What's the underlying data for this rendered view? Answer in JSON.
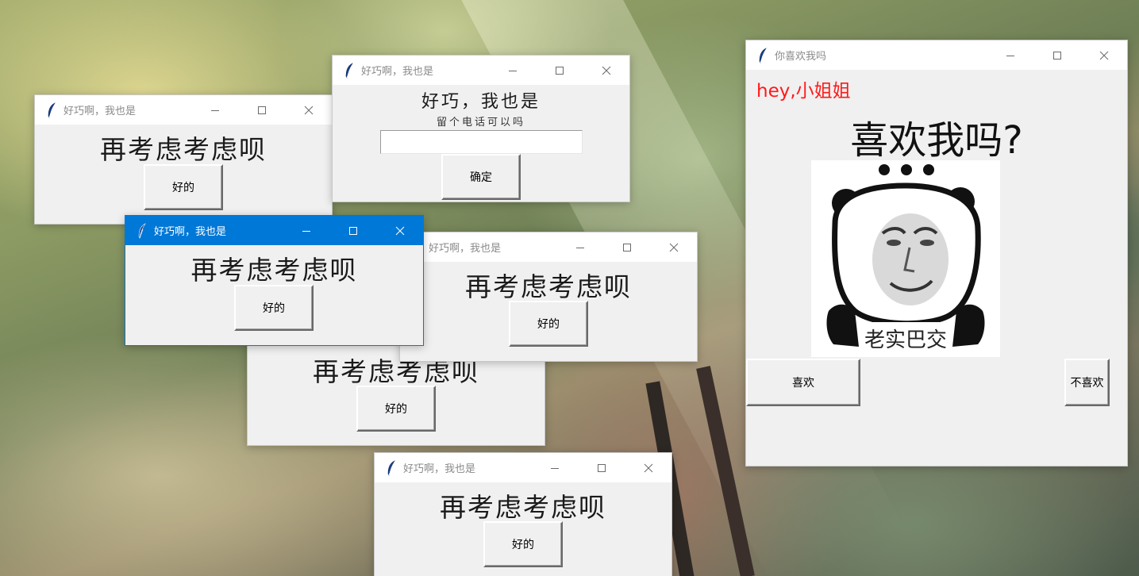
{
  "popup_title": "好巧啊，我也是",
  "reconsider_text": "再考虑考虑呗",
  "ok_label": "好的",
  "phone_window": {
    "title": "好巧啊，我也是",
    "heading": "好巧，我也是",
    "subtitle": "留个电话可以吗",
    "input_value": "",
    "confirm_label": "确定"
  },
  "main_window": {
    "title": "你喜欢我吗",
    "greeting": "hey,小姐姐",
    "question": "喜欢我吗?",
    "image_caption": "老实巴交",
    "like_label": "喜欢",
    "dislike_label": "不喜欢",
    "greeting_color": "#ff1a1a"
  },
  "icons": {
    "app_icon": "feather-icon",
    "minimize": "minimize-icon",
    "maximize": "maximize-icon",
    "close": "close-icon"
  }
}
